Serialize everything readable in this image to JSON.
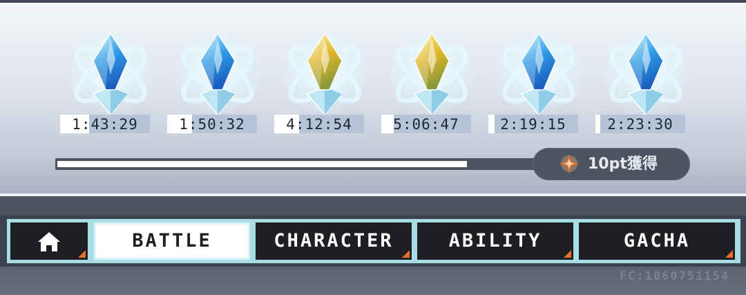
{
  "crystals": [
    {
      "timer": "1:43:29",
      "type": "blue",
      "progress": 0.32
    },
    {
      "timer": "1:50:32",
      "type": "blue",
      "progress": 0.28
    },
    {
      "timer": "4:12:54",
      "type": "gold",
      "progress": 0.28
    },
    {
      "timer": "5:06:47",
      "type": "gold",
      "progress": 0.14
    },
    {
      "timer": "2:19:15",
      "type": "blue",
      "progress": 0.07
    },
    {
      "timer": "2:23:30",
      "type": "blue",
      "progress": 0.05
    }
  ],
  "point_progress": 0.83,
  "reward": {
    "label": "10pt獲得",
    "icon": "star-crystal-icon"
  },
  "nav": {
    "home_icon": "home-icon",
    "tabs": [
      {
        "label": "BATTLE",
        "active": true
      },
      {
        "label": "CHARACTER",
        "active": false
      },
      {
        "label": "ABILITY",
        "active": false
      },
      {
        "label": "GACHA",
        "active": false
      }
    ]
  },
  "friend_code": "FC:1060751154",
  "colors": {
    "accent": "#e8702a",
    "nav_dark": "#1e1f23",
    "frame": "#a9dde4",
    "blue_crystal": "#2f9be6",
    "gold_crystal": "#e0b52a"
  }
}
